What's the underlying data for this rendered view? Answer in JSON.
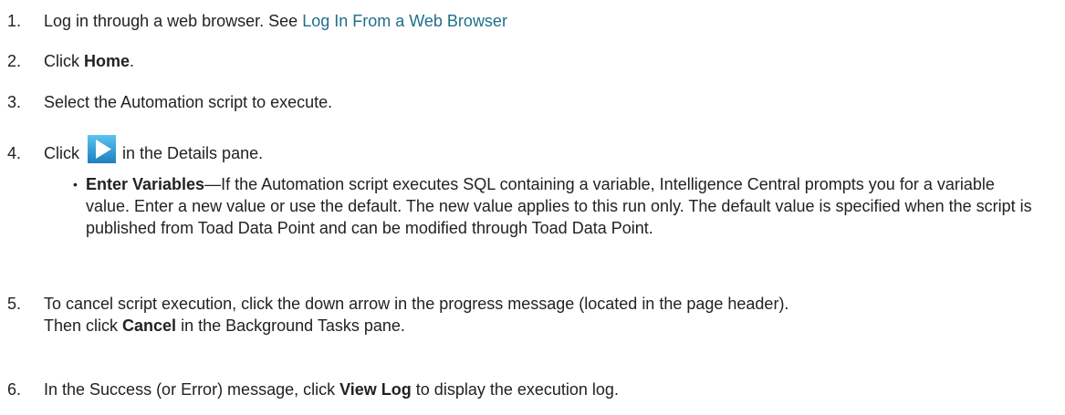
{
  "steps": [
    {
      "num": "1.",
      "text": "Log in through a web browser. See ",
      "link": "Log In From a Web Browser"
    },
    {
      "num": "2.",
      "pre": "Click ",
      "bold": "Home",
      "post": "."
    },
    {
      "num": "3.",
      "text": "Select the Automation script to execute."
    },
    {
      "num": "4.",
      "pre": "Click ",
      "post": " in the Details pane.",
      "icon": "play-icon",
      "sub": {
        "bullet": "•",
        "bold": "Enter Variables",
        "text": "—If the Automation script executes SQL containing a variable, Intelligence Central prompts you for a variable value. Enter a new value or use the default. The new value applies to this run only. The default value is specified when the script is published from Toad Data Point and can be modified through Toad Data Point."
      }
    },
    {
      "num": "5.",
      "line1": "To cancel script execution, click the down arrow in the progress message (located in the page header).",
      "pre": "Then click ",
      "bold": "Cancel",
      "post": " in the Background Tasks pane."
    },
    {
      "num": "6.",
      "pre": "In the Success (or Error) message, click ",
      "bold": "View Log",
      "post": " to display the execution log."
    }
  ],
  "colors": {
    "link": "#1f6f8b",
    "text": "#222222",
    "play_icon_fill": "#2a9fd6"
  }
}
